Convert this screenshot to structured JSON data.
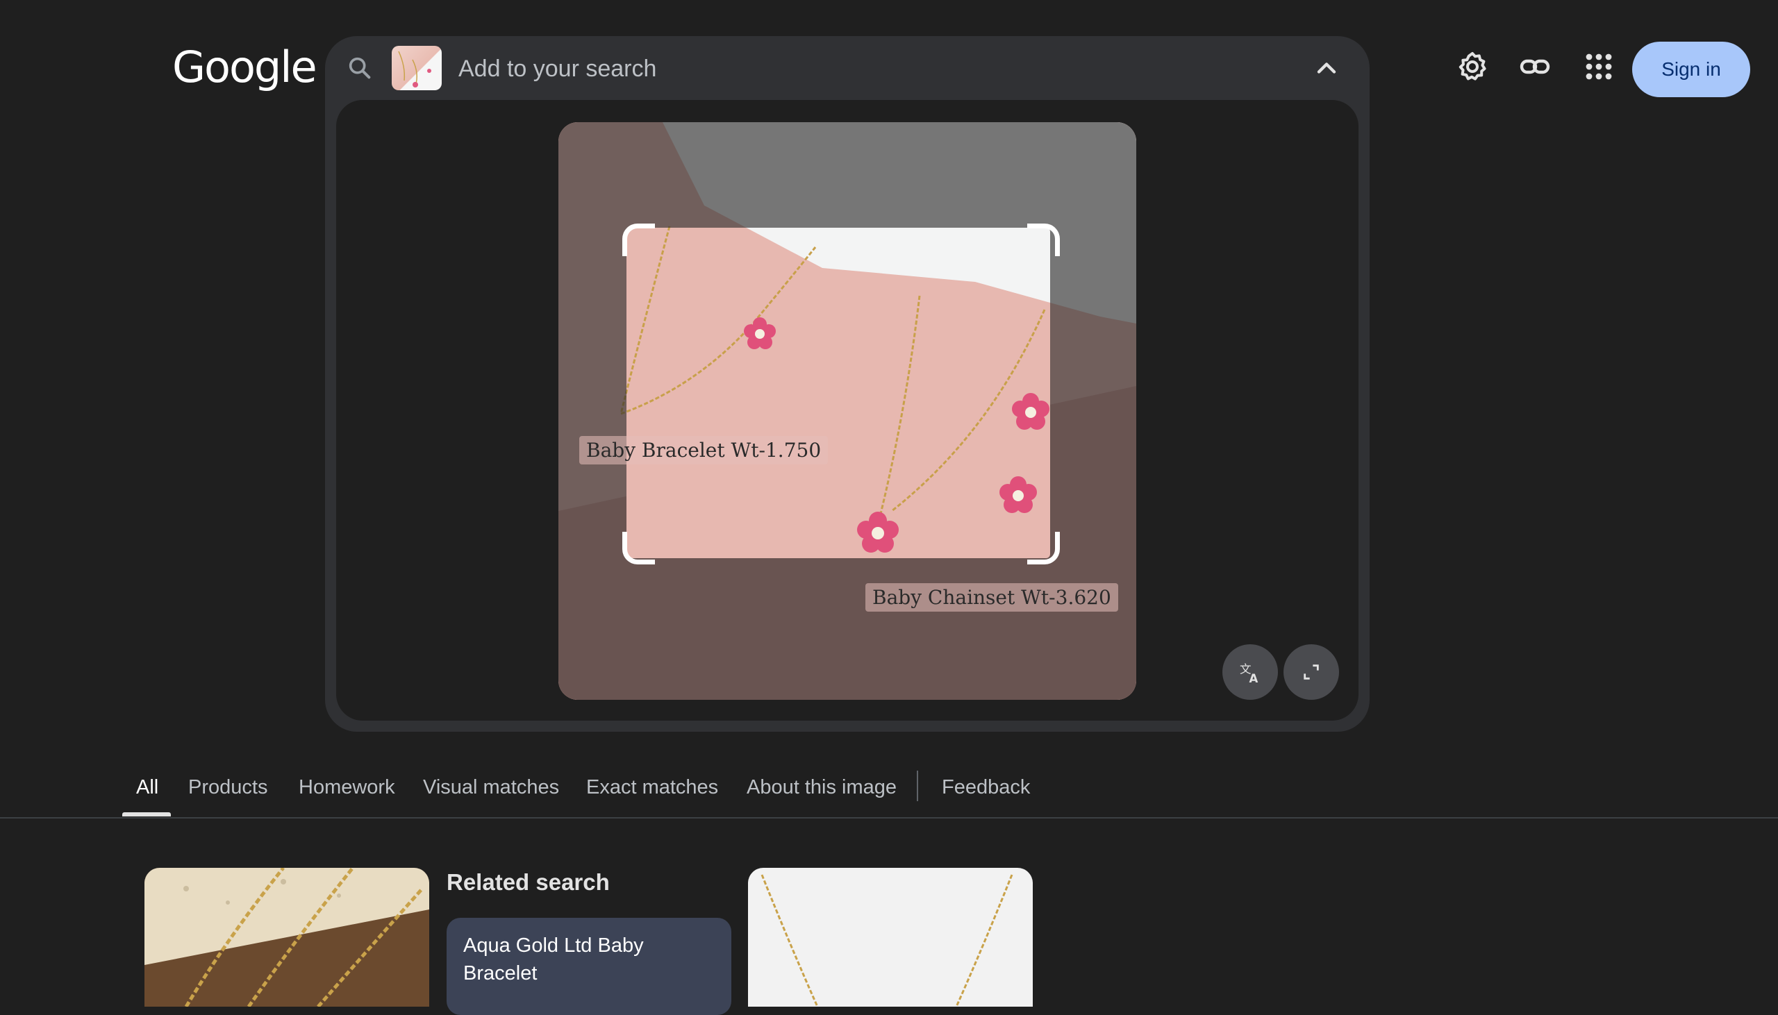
{
  "header": {
    "logo_text": "Google",
    "signin_label": "Sign in",
    "icons": [
      "settings-icon",
      "link-icon",
      "apps-grid-icon"
    ]
  },
  "search": {
    "placeholder": "Add to your search",
    "icons": [
      "search-icon",
      "chevron-up-icon"
    ]
  },
  "image": {
    "labels": {
      "bracelet": "Baby Bracelet Wt-1.750",
      "chainset": "Baby Chainset Wt-3.620"
    },
    "buttons": [
      "translate-icon",
      "expand-icon"
    ]
  },
  "tabs": [
    {
      "label": "All",
      "active": true
    },
    {
      "label": "Products"
    },
    {
      "label": "Homework"
    },
    {
      "label": "Visual matches"
    },
    {
      "label": "Exact matches"
    },
    {
      "label": "About this image"
    },
    {
      "label": "Feedback"
    }
  ],
  "results": {
    "related_heading": "Related search",
    "related_item": "Aqua Gold Ltd Baby Bracelet"
  },
  "colors": {
    "background": "#1f1f1f",
    "panel": "#303134",
    "signin_bg": "#a8c7fa",
    "chip_bg": "#3c4356"
  }
}
